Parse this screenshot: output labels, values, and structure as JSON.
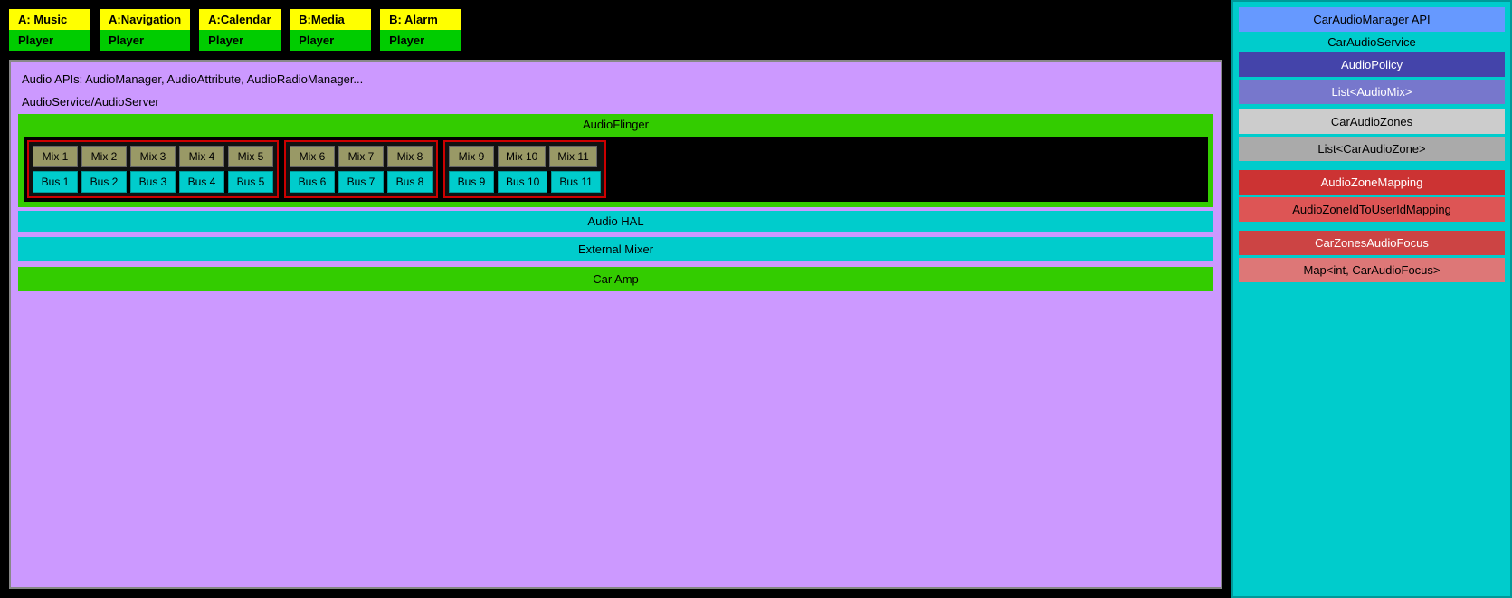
{
  "apps": [
    {
      "top": "A: Music",
      "bottom": "Player"
    },
    {
      "top": "A:Navigation",
      "bottom": "Player"
    },
    {
      "top": "A:Calendar",
      "bottom": "Player"
    },
    {
      "top": "B:Media",
      "bottom": "Player"
    },
    {
      "top": "B: Alarm",
      "bottom": "Player"
    }
  ],
  "diagram": {
    "audio_apis": "Audio APIs: AudioManager, AudioAttribute, AudioRadioManager...",
    "audio_service": "AudioService/AudioServer",
    "audioflinger": "AudioFlinger",
    "audio_hal": "Audio HAL",
    "external_mixer": "External Mixer",
    "car_amp": "Car Amp",
    "groups": [
      {
        "mixes": [
          "Mix 1",
          "Mix 2",
          "Mix 3",
          "Mix 4",
          "Mix 5"
        ],
        "buses": [
          "Bus 1",
          "Bus 2",
          "Bus 3",
          "Bus 4",
          "Bus 5"
        ]
      },
      {
        "mixes": [
          "Mix 6",
          "Mix 7",
          "Mix 8"
        ],
        "buses": [
          "Bus 6",
          "Bus 7",
          "Bus 8"
        ]
      },
      {
        "mixes": [
          "Mix 9",
          "Mix 10",
          "Mix 11"
        ],
        "buses": [
          "Bus 9",
          "Bus 10",
          "Bus 11"
        ]
      }
    ]
  },
  "right_panel": {
    "car_audio_manager": "CarAudioManager API",
    "car_audio_service": "CarAudioService",
    "audio_policy": "AudioPolicy",
    "list_audio_mix": "List<AudioMix>",
    "car_audio_zones": "CarAudioZones",
    "list_car_audio_zone": "List<CarAudioZone>",
    "audio_zone_mapping": "AudioZoneMapping",
    "audio_zone_id_mapping": "AudioZoneIdToUserIdMapping",
    "car_zones_audio_focus": "CarZonesAudioFocus",
    "map_car_audio_focus": "Map<int, CarAudioFocus>"
  }
}
